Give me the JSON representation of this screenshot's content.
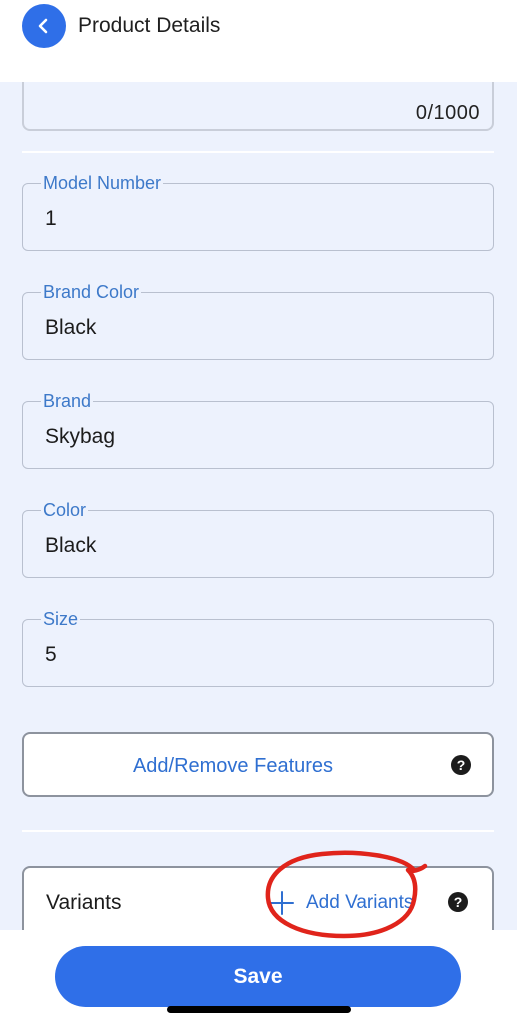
{
  "header": {
    "title": "Product Details",
    "back_icon": "chevron-left-icon"
  },
  "description": {
    "counter": "0/1000"
  },
  "fields": [
    {
      "label": "Model Number",
      "value": "1"
    },
    {
      "label": "Brand Color",
      "value": "Black"
    },
    {
      "label": "Brand",
      "value": "Skybag"
    },
    {
      "label": "Color",
      "value": "Black"
    },
    {
      "label": "Size",
      "value": "5"
    }
  ],
  "features": {
    "label": "Add/Remove Features",
    "help_icon": "question-circle-icon"
  },
  "variants": {
    "label": "Variants",
    "add_label": "Add Variants",
    "add_icon": "plus-icon",
    "help_icon": "question-circle-icon",
    "annotation": "red hand-drawn circle around Add Variants"
  },
  "footer": {
    "save_label": "Save"
  },
  "colors": {
    "accent": "#2f6fe8",
    "link": "#2f6fd1",
    "field_label": "#3d79c9",
    "background": "#edf2fd",
    "annotation": "#e0241b"
  }
}
